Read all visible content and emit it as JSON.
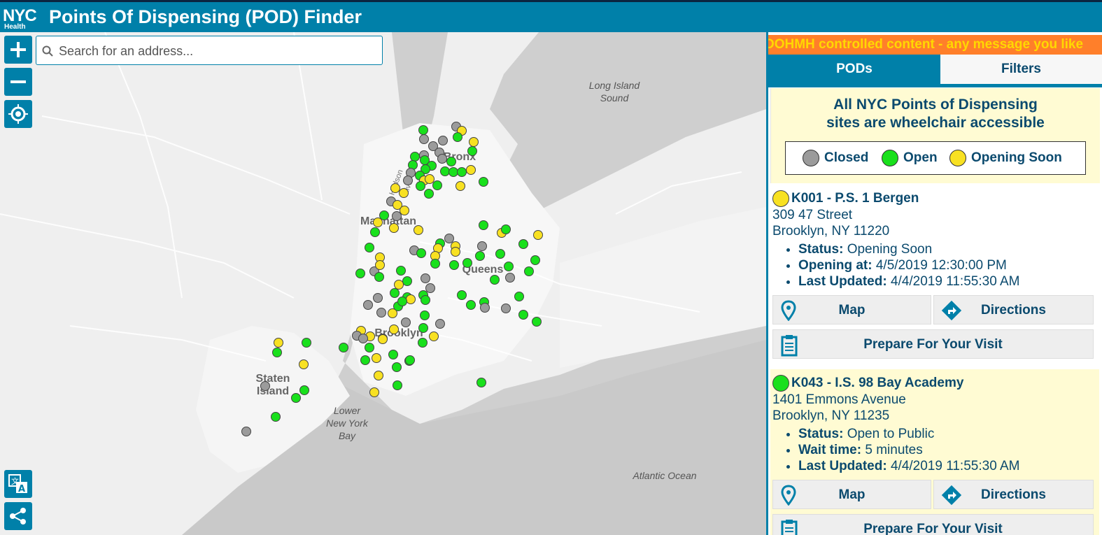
{
  "header": {
    "logo_text": "NYC",
    "logo_sub": "Health",
    "title": "Points Of Dispensing (POD) Finder"
  },
  "search": {
    "placeholder": "Search for an address..."
  },
  "map": {
    "labels": {
      "bronx": "Bronx",
      "manhattan": "Manhattan",
      "queens": "Queens",
      "brooklyn": "Brooklyn",
      "staten_island_1": "Staten",
      "staten_island_2": "Island",
      "long_island_sound_1": "Long Island",
      "long_island_sound_2": "Sound",
      "lower_ny_bay_1": "Lower",
      "lower_ny_bay_2": "New York",
      "lower_ny_bay_3": "Bay",
      "atlantic": "Atlantic Ocean",
      "hudson": "Hudson River"
    },
    "status_colors": {
      "closed": "#9b9b9b",
      "open": "#19e01c",
      "opening_soon": "#f8e122"
    }
  },
  "panel": {
    "banner": "DOHMH controlled content - any message you like",
    "tabs": {
      "pods": "PODs",
      "filters": "Filters"
    },
    "accessibility_line1": "All NYC Points of Dispensing",
    "accessibility_line2": "sites are wheelchair accessible",
    "legend": {
      "closed": "Closed",
      "open": "Open",
      "opening_soon": "Opening Soon"
    },
    "pods": [
      {
        "name": "K001 - P.S. 1 Bergen",
        "street": "309 47 Street",
        "city": "Brooklyn, NY 11220",
        "status_label": "Status:",
        "status": "Opening Soon",
        "detail_label": "Opening at:",
        "detail": "4/5/2019 12:30:00 PM",
        "updated_label": "Last Updated:",
        "updated": "4/4/2019 11:55:30 AM",
        "map_label": "Map",
        "directions_label": "Directions",
        "prepare_label": "Prepare For Your Visit"
      },
      {
        "name": "K043 - I.S. 98 Bay Academy",
        "street": "1401 Emmons Avenue",
        "city": "Brooklyn, NY 11235",
        "status_label": "Status:",
        "status": "Open to Public",
        "detail_label": "Wait time:",
        "detail": "5 minutes",
        "updated_label": "Last Updated:",
        "updated": "4/4/2019 11:55:30 AM",
        "map_label": "Map",
        "directions_label": "Directions",
        "prepare_label": "Prepare For Your Visit"
      }
    ]
  }
}
